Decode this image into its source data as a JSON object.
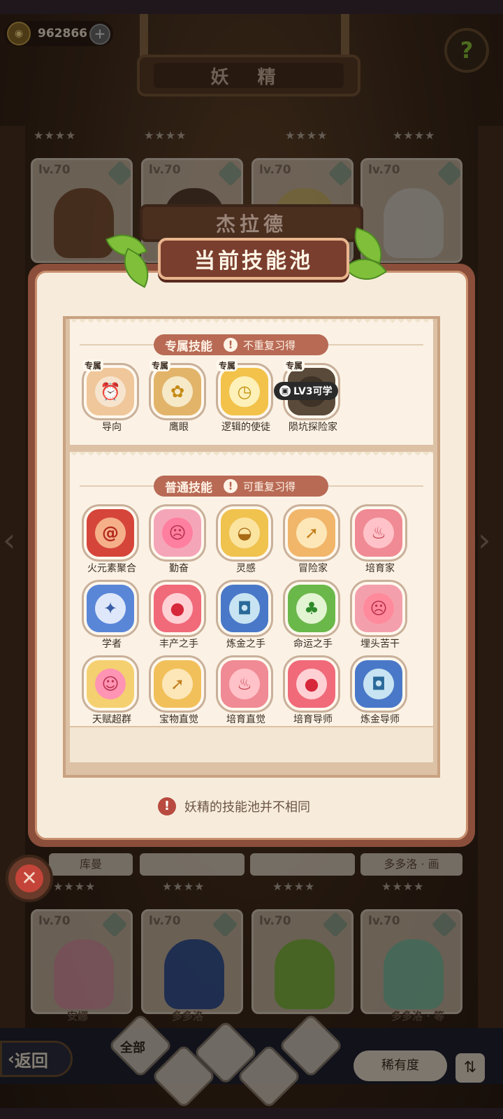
{
  "header": {
    "currency_amount": "962866",
    "title": "妖 精",
    "help_icon": "question-leaf-icon"
  },
  "background": {
    "top_cards": [
      {
        "level": "lv.70"
      },
      {
        "level": "lv.70"
      },
      {
        "level": "lv.70"
      },
      {
        "level": "lv.70"
      }
    ],
    "middle_names": [
      "库曼",
      "",
      "",
      "多多洛 · 画"
    ],
    "bottom_cards": [
      {
        "level": "lv.70",
        "name": "安娜"
      },
      {
        "level": "lv.70",
        "name": "多多洛"
      },
      {
        "level": "lv.70",
        "name": ""
      },
      {
        "level": "lv.70",
        "name": "多多洛 · 等"
      }
    ],
    "star_text": "★★★★"
  },
  "popup": {
    "character_name": "杰拉德",
    "title": "当前技能池",
    "exclusive_section": {
      "title": "专属技能",
      "note": "不重复习得",
      "skills": [
        {
          "name": "导向",
          "tag": "专属",
          "icon": "alarm-clock-icon"
        },
        {
          "name": "鹰眼",
          "tag": "专属",
          "icon": "bee-icon"
        },
        {
          "name": "逻辑的使徒",
          "tag": "专属",
          "icon": "clock-icon"
        },
        {
          "name": "陨坑探险家",
          "tag": "专属",
          "icon": "crater-icon",
          "locked_label": "LV3可学"
        }
      ]
    },
    "normal_section": {
      "title": "普通技能",
      "note": "可重复习得",
      "skills": [
        {
          "name": "火元素聚合",
          "icon": "fire-swirl-icon"
        },
        {
          "name": "勤奋",
          "icon": "angry-face-icon"
        },
        {
          "name": "灵感",
          "icon": "cauldron-icon"
        },
        {
          "name": "冒险家",
          "icon": "treasure-bag-icon"
        },
        {
          "name": "培育家",
          "icon": "watering-can-icon"
        },
        {
          "name": "学者",
          "icon": "shell-icon"
        },
        {
          "name": "丰产之手",
          "icon": "tomato-icon"
        },
        {
          "name": "炼金之手",
          "icon": "pot-icon"
        },
        {
          "name": "命运之手",
          "icon": "clover-icon"
        },
        {
          "name": "埋头苦干",
          "icon": "grumpy-face-icon"
        },
        {
          "name": "天赋超群",
          "icon": "surprised-face-icon"
        },
        {
          "name": "宝物直觉",
          "icon": "treasure-bag-icon"
        },
        {
          "name": "培育直觉",
          "icon": "watering-can-icon"
        },
        {
          "name": "培育导师",
          "icon": "tomato-icon"
        },
        {
          "name": "炼金导师",
          "icon": "pot-icon"
        }
      ]
    },
    "footer_note": "妖精的技能池并不相同"
  },
  "bottom_bar": {
    "back_label": "返回",
    "all_label": "全部",
    "rarity_label": "稀有度"
  },
  "colors": {
    "panel_border": "#8a4e3a",
    "banner": "#7a3e2e",
    "section_header": "#b86a55"
  }
}
